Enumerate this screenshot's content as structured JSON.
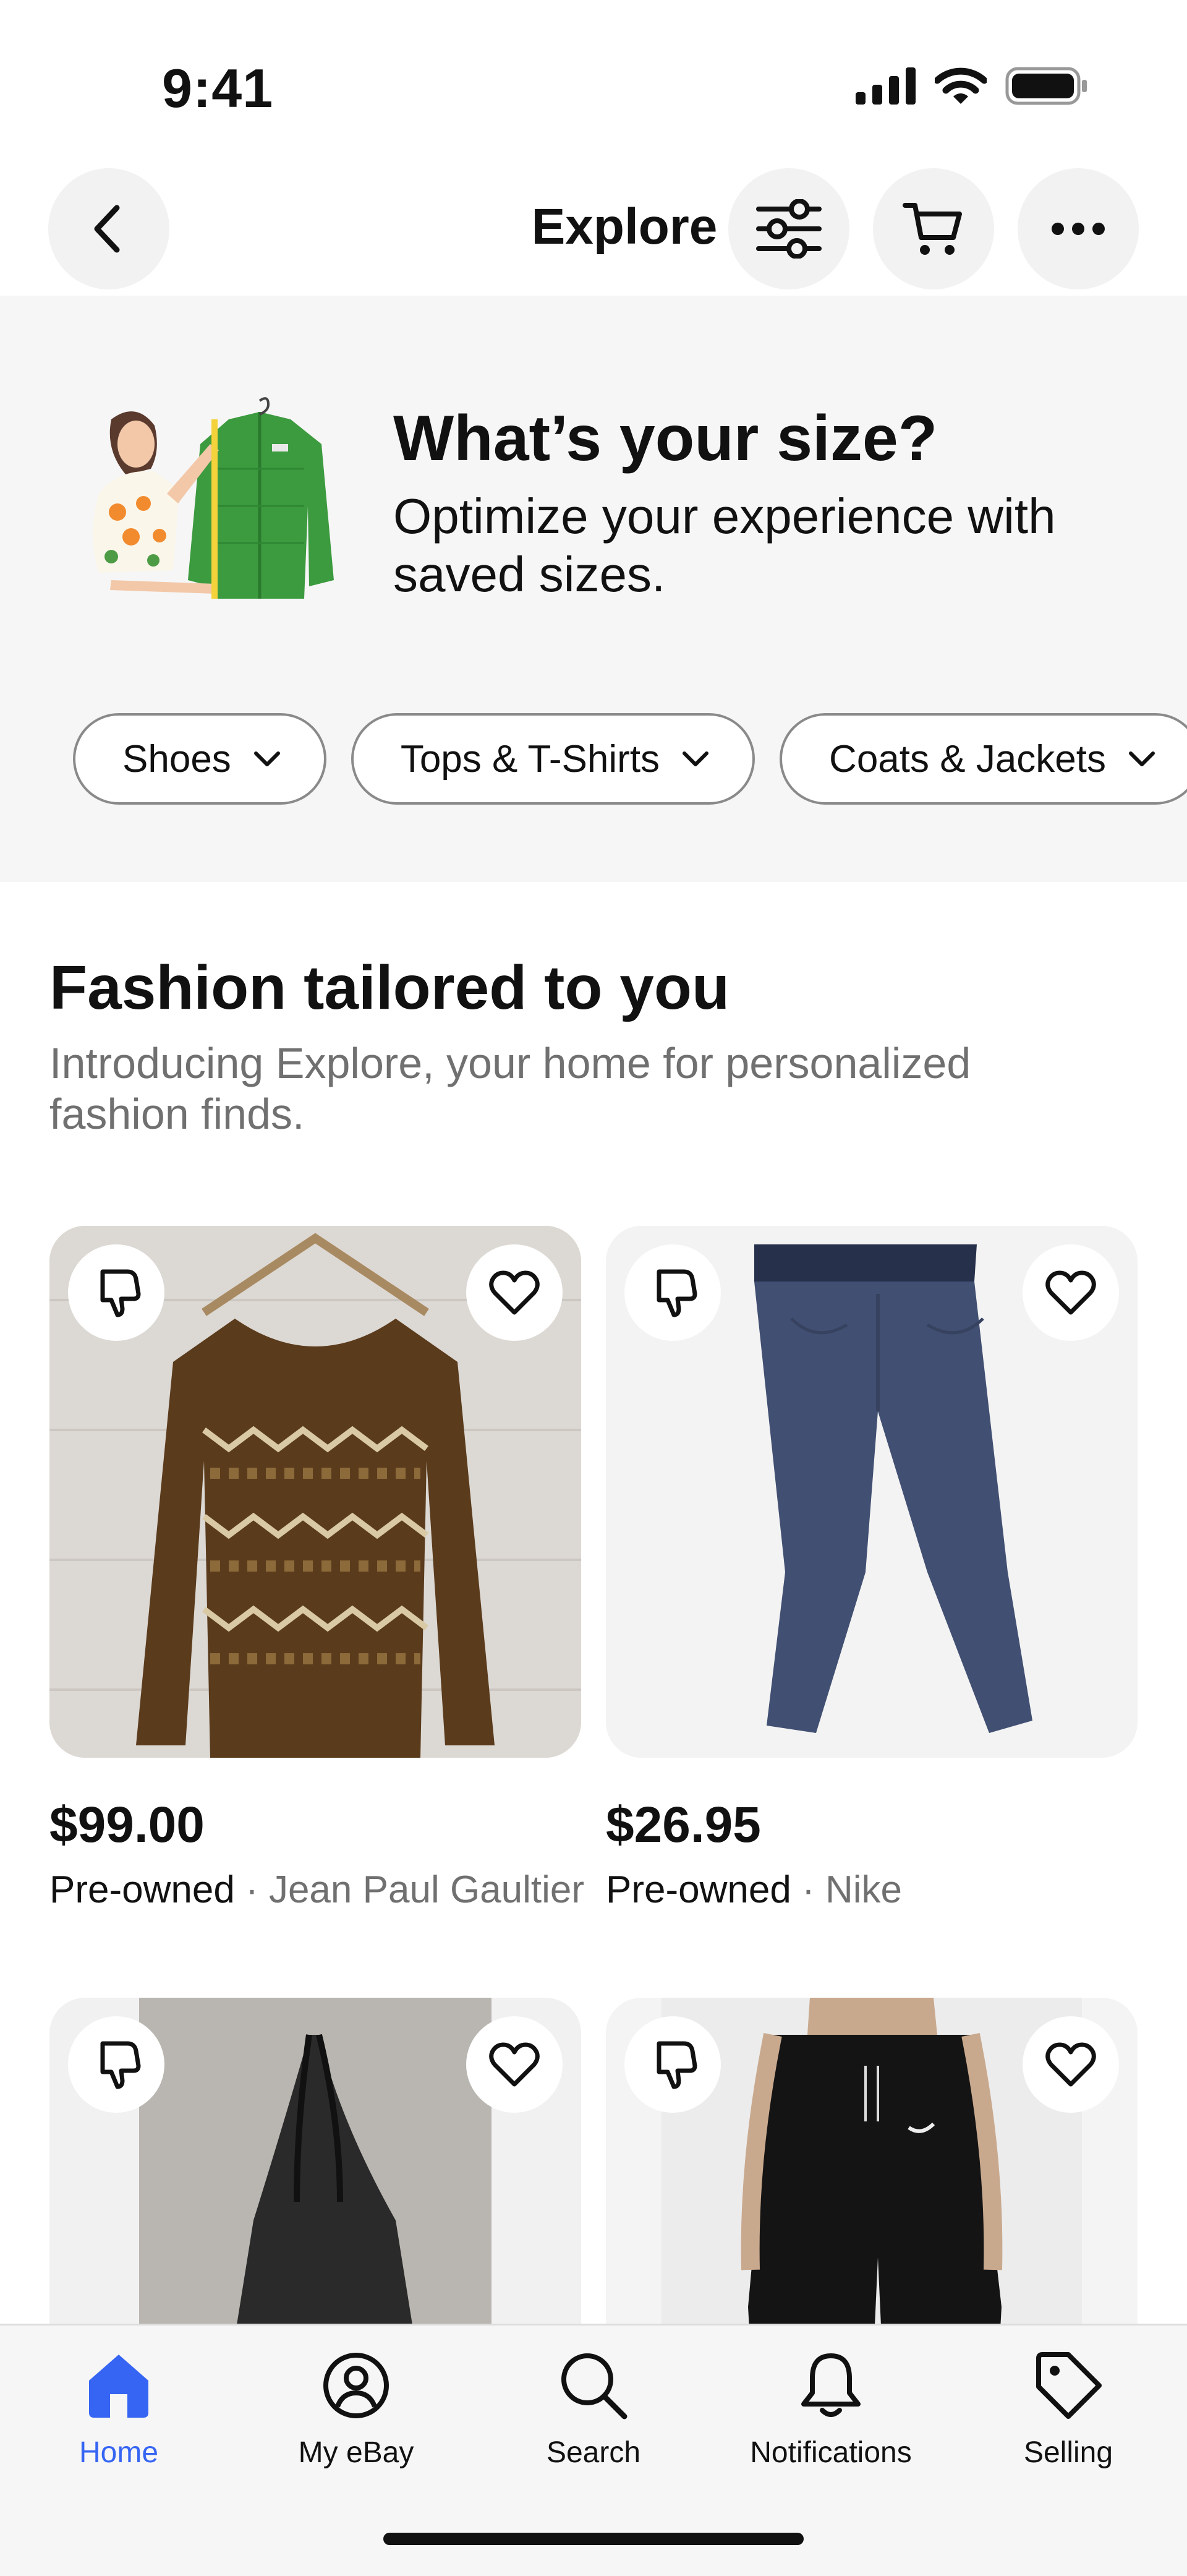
{
  "status_bar": {
    "time": "9:41"
  },
  "nav": {
    "title": "Explore"
  },
  "size_banner": {
    "title": "What’s your size?",
    "subtitle": "Optimize your experience with saved sizes.",
    "chips": [
      "Shoes",
      "Tops & T-Shirts",
      "Coats & Jackets"
    ]
  },
  "section": {
    "title": "Fashion tailored to you",
    "subtitle": "Introducing Explore, your home for personalized fashion finds."
  },
  "products": [
    {
      "price": "$99.00",
      "condition": "Pre-owned",
      "separator": "·",
      "brand": "Jean Paul Gaultier"
    },
    {
      "price": "$26.95",
      "condition": "Pre-owned",
      "separator": "·",
      "brand": "Nike"
    }
  ],
  "tabs": [
    {
      "label": "Home",
      "icon": "home-icon",
      "active": true
    },
    {
      "label": "My eBay",
      "icon": "user-icon",
      "active": false
    },
    {
      "label": "Search",
      "icon": "search-icon",
      "active": false
    },
    {
      "label": "Notifications",
      "icon": "bell-icon",
      "active": false
    },
    {
      "label": "Selling",
      "icon": "tag-icon",
      "active": false
    }
  ],
  "colors": {
    "accent": "#3665f3",
    "text": "#111111",
    "secondary_text": "#707070",
    "banner_bg": "#f6f6f6"
  }
}
